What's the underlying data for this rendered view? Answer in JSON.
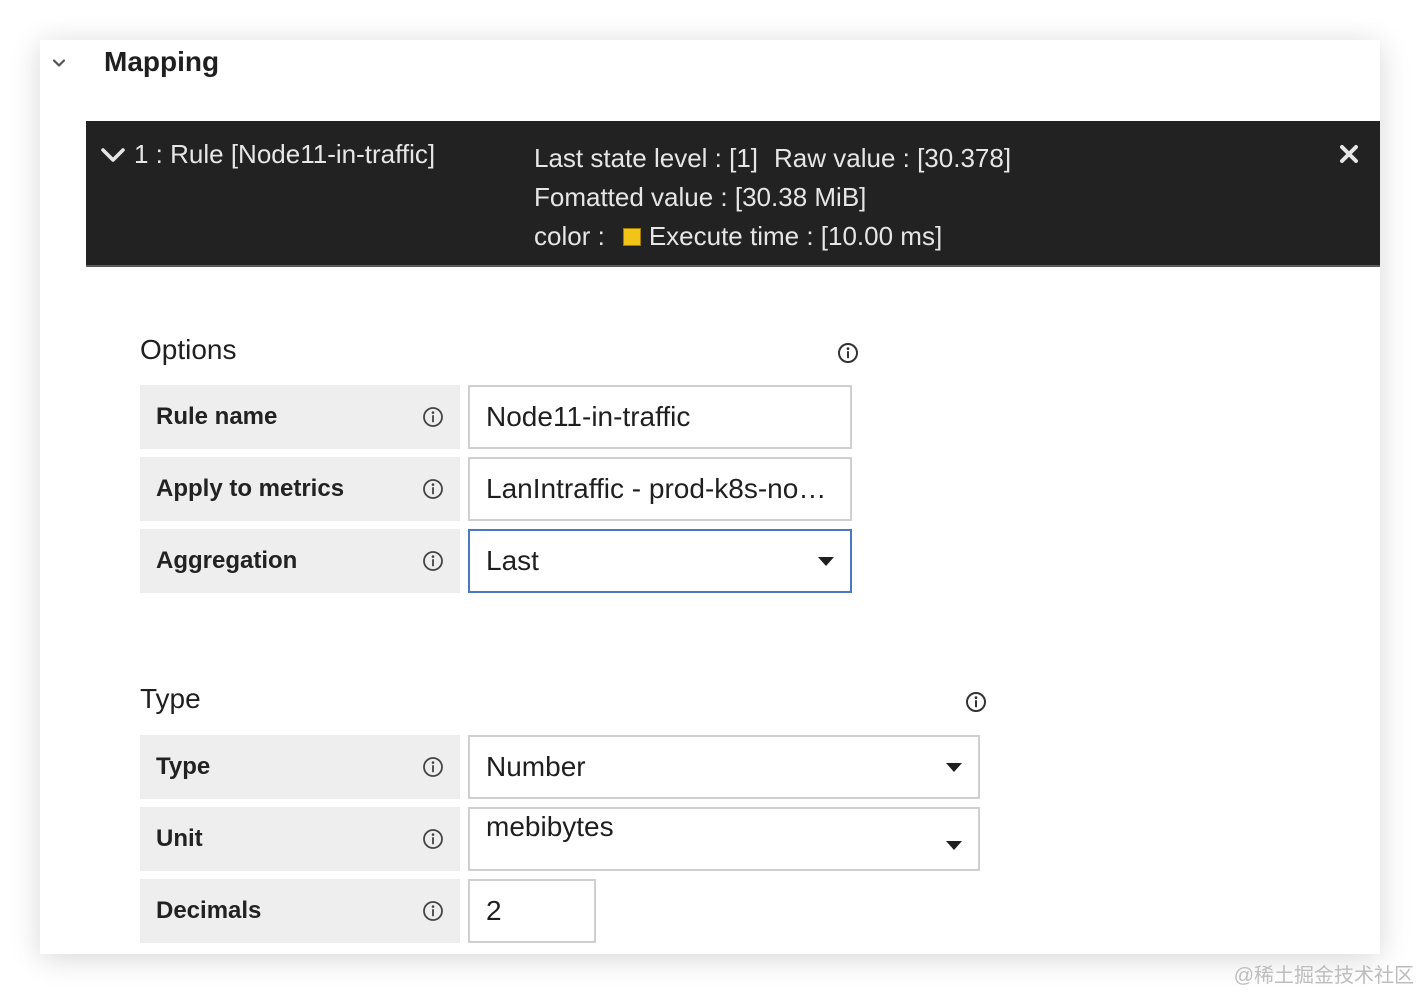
{
  "section": {
    "title": "Mapping"
  },
  "rule": {
    "title": "1 : Rule [Node11-in-traffic]",
    "last_state_level": "Last state level : [1]",
    "raw_value": "Raw value : [30.378]",
    "formatted_value": "Fomatted value : [30.38 MiB]",
    "color_label": "color :",
    "color_value": "#f2c418",
    "execute_time": "Execute time : [10.00 ms]"
  },
  "options": {
    "title": "Options",
    "rule_name": {
      "label": "Rule name",
      "value": "Node11-in-traffic"
    },
    "apply_to_metrics": {
      "label": "Apply to metrics",
      "value": "LanIntraffic - prod-k8s-nod…"
    },
    "aggregation": {
      "label": "Aggregation",
      "value": "Last"
    }
  },
  "type_group": {
    "title": "Type",
    "type": {
      "label": "Type",
      "value": "Number"
    },
    "unit": {
      "label": "Unit",
      "value": "mebibytes"
    },
    "decimals": {
      "label": "Decimals",
      "value": "2"
    }
  },
  "watermark": "@稀土掘金技术社区"
}
